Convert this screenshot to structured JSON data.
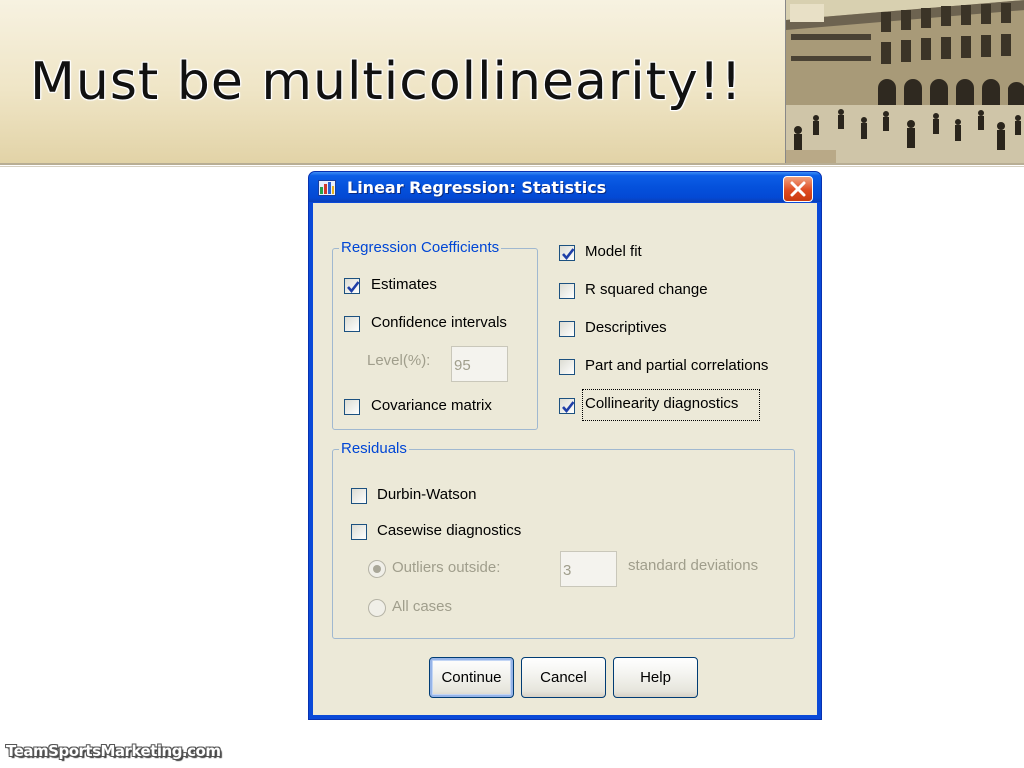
{
  "slide": {
    "title": "Must be multicollinearity!!",
    "watermark": "TeamSportsMarketing.com"
  },
  "dialog": {
    "title": "Linear Regression: Statistics",
    "regression_coefficients": {
      "legend": "Regression Coefficients",
      "estimates": {
        "label": "Estimates",
        "checked": true
      },
      "confidence_intervals": {
        "label": "Confidence intervals",
        "checked": false
      },
      "level_label": "Level(%):",
      "level_value": "95",
      "covariance_matrix": {
        "label": "Covariance matrix",
        "checked": false
      }
    },
    "right_options": {
      "model_fit": {
        "label": "Model fit",
        "checked": true
      },
      "r_squared_change": {
        "label": "R squared change",
        "checked": false
      },
      "descriptives": {
        "label": "Descriptives",
        "checked": false
      },
      "part_partial": {
        "label": "Part and partial correlations",
        "checked": false
      },
      "collinearity": {
        "label": "Collinearity diagnostics",
        "checked": true
      }
    },
    "residuals": {
      "legend": "Residuals",
      "durbin_watson": {
        "label": "Durbin-Watson",
        "checked": false
      },
      "casewise": {
        "label": "Casewise diagnostics",
        "checked": false
      },
      "outliers_label": "Outliers outside:",
      "outliers_value": "3",
      "std_dev_label": "standard deviations",
      "all_cases_label": "All cases"
    },
    "buttons": {
      "continue": "Continue",
      "cancel": "Cancel",
      "help": "Help"
    }
  },
  "colors": {
    "titlebar": "#0551dc",
    "dialog_face": "#ece9d8",
    "legend_text": "#0046d5",
    "check_mark": "#1f3fa8",
    "close_button": "#df4b22"
  }
}
